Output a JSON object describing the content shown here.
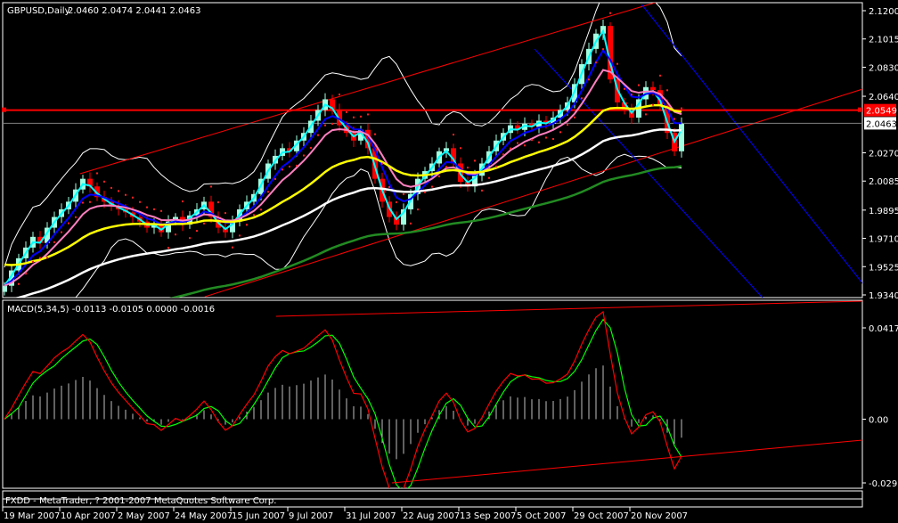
{
  "chart_data": {
    "type": "candlestick",
    "symbol_label": "GBPUSD,Daily",
    "ohlc_label": "2.0460 2.0474 2.0441 2.0463",
    "ylim": [
      1.934,
      2.12
    ],
    "price_ticks": [
      "2.1200",
      "2.1015",
      "2.0830",
      "2.0640",
      "2.0463",
      "2.0270",
      "2.0085",
      "1.9895",
      "1.9710",
      "1.9525",
      "1.9340"
    ],
    "price_tick_values": [
      2.12,
      2.1015,
      2.083,
      2.064,
      2.0463,
      2.027,
      2.0085,
      1.9895,
      1.971,
      1.9525,
      1.934
    ],
    "marker_line": {
      "label": "2.0549",
      "value": 2.0549,
      "color": "#ff0000"
    },
    "bid_line": {
      "label": "2.0463",
      "value": 2.0463
    },
    "date_ticks": [
      "19 Mar 2007",
      "10 Apr 2007",
      "2 May 2007",
      "24 May 2007",
      "15 Jun 2007",
      "9 Jul 2007",
      "31 Jul 2007",
      "22 Aug 2007",
      "13 Sep 2007",
      "5 Oct 2007",
      "29 Oct 2007",
      "20 Nov 2007"
    ],
    "bars_per_date_tick": 8,
    "closes": [
      1.94,
      1.95,
      1.958,
      1.965,
      1.972,
      1.968,
      1.978,
      1.985,
      1.99,
      1.995,
      2.003,
      2.01,
      2.005,
      1.998,
      1.995,
      1.992,
      1.99,
      1.988,
      1.985,
      1.982,
      1.978,
      1.98,
      1.975,
      1.982,
      1.985,
      1.98,
      1.986,
      1.99,
      1.995,
      1.985,
      1.978,
      1.975,
      1.982,
      1.99,
      1.995,
      2.0,
      2.01,
      2.02,
      2.025,
      2.03,
      2.028,
      2.035,
      2.04,
      2.048,
      2.055,
      2.062,
      2.055,
      2.045,
      2.04,
      2.035,
      2.042,
      2.03,
      2.01,
      1.995,
      1.985,
      1.98,
      1.99,
      2.0,
      2.01,
      2.015,
      2.02,
      2.028,
      2.03,
      2.02,
      2.008,
      2.005,
      2.012,
      2.02,
      2.028,
      2.035,
      2.04,
      2.045,
      2.042,
      2.046,
      2.044,
      2.048,
      2.046,
      2.05,
      2.055,
      2.06,
      2.072,
      2.085,
      2.095,
      2.105,
      2.11,
      2.075,
      2.06,
      2.055,
      2.05,
      2.062,
      2.07,
      2.068,
      2.058,
      2.04,
      2.028,
      2.046
    ],
    "trend_lines": [
      {
        "name": "upper-channel",
        "color": "#ff0000",
        "p1": [
          10.6,
          2.0133
        ],
        "p2": [
          91.25,
          2.1252
        ]
      },
      {
        "name": "lower-channel",
        "color": "#ff0000",
        "p1": [
          28.1,
          1.9328
        ],
        "p2": [
          120.4,
          2.0687
        ]
      },
      {
        "name": "down-channel-1",
        "color": "#0000ff",
        "p1": [
          74.4,
          2.0949
        ],
        "p2": [
          106.25,
          1.9328
        ]
      },
      {
        "name": "down-channel-2",
        "color": "#0000ff",
        "p1": [
          89.4,
          2.1241
        ],
        "p2": [
          120.4,
          1.9416
        ]
      }
    ],
    "moving_averages": [
      {
        "name": "fast",
        "color": "#00ffff",
        "period": 2
      },
      {
        "name": "medium",
        "color": "#0000ff",
        "period": 5
      },
      {
        "name": "pink",
        "color": "#ff80c0",
        "period": 9
      },
      {
        "name": "yellow",
        "color": "#ffff00",
        "period": 25,
        "seed": 1.955
      },
      {
        "name": "white",
        "color": "#ffffff",
        "period": 50,
        "seed": 1.93
      },
      {
        "name": "green",
        "color": "#228b22",
        "period": 90,
        "seed": 1.895
      }
    ],
    "macd": {
      "label": "MACD(5,34,5) -0.0113 -0.0105 0.0000 -0.0016",
      "ylim": [
        -0.0291,
        0.0417
      ],
      "ticks": [
        "0.0417",
        "0.00",
        "-0.0291"
      ],
      "tick_values": [
        0.0417,
        0,
        -0.0291
      ],
      "colors": {
        "macd": "#ff0000",
        "signal": "#00ff00",
        "hist": "#c0c0c0"
      }
    }
  },
  "footer": {
    "copyright": "FXDD - MetaTrader, ? 2001-2007 MetaQuotes Software Corp."
  }
}
